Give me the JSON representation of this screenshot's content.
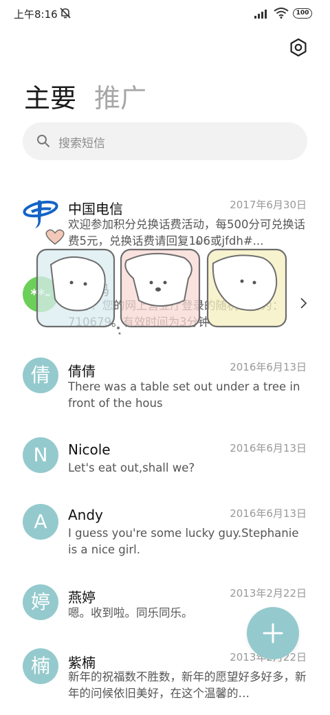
{
  "status_bar": {
    "time": "上午8:16",
    "battery": "100"
  },
  "tabs": {
    "main": "主要",
    "promo": "推广"
  },
  "search": {
    "placeholder": "搜索短信"
  },
  "messages": [
    {
      "sender": "中国电信",
      "date": "2017年6月30日",
      "preview": "欢迎参加积分兑换话费活动，每500分可兑换话费5元，兑换话费请回复106或jfdh#...",
      "avatar": "telecom-logo"
    },
    {
      "sender": "验证码",
      "date": "",
      "preview": "您好！您的网上营业厅登录的随机密码为：710679。有效时间为3分钟",
      "avatar": "**-"
    },
    {
      "sender": "倩倩",
      "date": "2016年6月13日",
      "preview": "There was a table set out under a tree in front of the hous",
      "avatar": "倩"
    },
    {
      "sender": "Nicole",
      "date": "2016年6月13日",
      "preview": "Let's eat out,shall we?",
      "avatar": "N"
    },
    {
      "sender": "Andy",
      "date": "2016年6月13日",
      "preview": "I guess you're some lucky guy.Stephanie is a nice girl.",
      "avatar": "A"
    },
    {
      "sender": "燕婷",
      "date": "2013年2月22日",
      "preview": "嗯。收到啦。同乐同乐。",
      "avatar": "婷"
    },
    {
      "sender": "紫楠",
      "date": "2013年2月22日",
      "preview": "新年的祝福数不胜数，新年的愿望好多好多，新年的问候依旧美好，在这个温馨的…",
      "avatar": "楠"
    }
  ],
  "colors": {
    "avatar_bg": "#94cacd",
    "verify_avatar_bg": "#6bcf5a",
    "telecom_blue": "#1463c6"
  }
}
